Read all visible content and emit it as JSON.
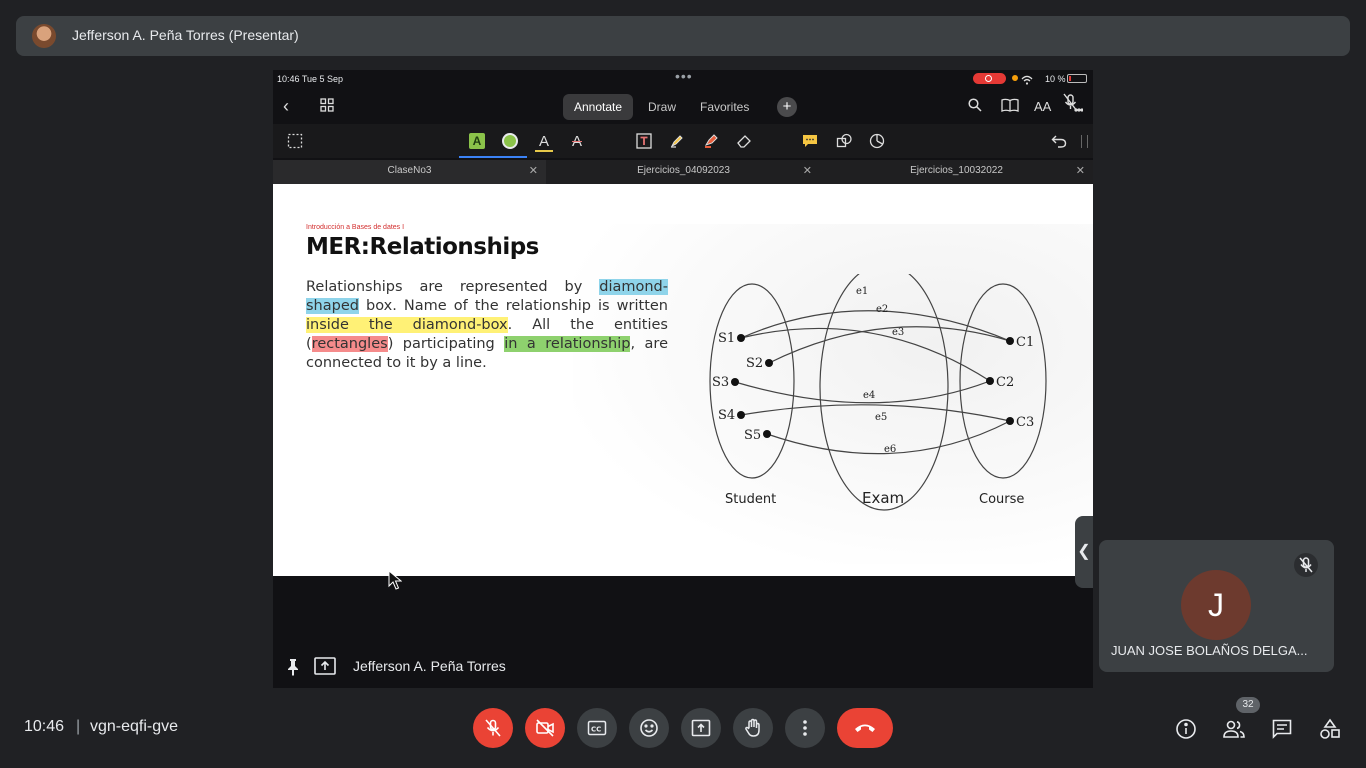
{
  "presenter_bar": {
    "name": "Jefferson A. Peña Torres (Presentar)"
  },
  "tablet": {
    "status": {
      "time_date": "10:46  Tue 5 Sep",
      "battery": "10 %"
    },
    "nav": {
      "tabs": [
        "Annotate",
        "Draw",
        "Favorites"
      ],
      "active_tab": "Annotate",
      "text_size_label": "AA"
    },
    "doc_tabs": [
      "ClaseNo3",
      "Ejercicios_04092023",
      "Ejercicios_10032022"
    ],
    "slide": {
      "course": "Introducción a Bases de dates I",
      "title": "MER:Relationships",
      "body": {
        "t1": "Relationships are represented by ",
        "h1": "diamond-shaped",
        "t2": " box. Name of the relationship is written ",
        "h2": "inside the diamond-box",
        "t3": ". All the entities (",
        "h3": "rectangles",
        "t4": ") participating ",
        "h4": "in a relationship",
        "t5": ", are connected to it by a line."
      },
      "diagram": {
        "sets": [
          "Student",
          "Exam",
          "Course"
        ],
        "students": [
          "S1",
          "S2",
          "S3",
          "S4",
          "S5"
        ],
        "courses": [
          "C1",
          "C2",
          "C3"
        ],
        "exams": [
          "e1",
          "e2",
          "e3",
          "e4",
          "e5",
          "e6"
        ]
      }
    }
  },
  "shared_by": "Jefferson A. Peña Torres",
  "participant_tile": {
    "initial": "J",
    "name": "JUAN JOSE BOLAÑOS DELGA..."
  },
  "bottom_bar": {
    "clock": "10:46",
    "separator": "|",
    "meeting_code": "vgn-eqfi-gve",
    "participants_count": "32"
  }
}
